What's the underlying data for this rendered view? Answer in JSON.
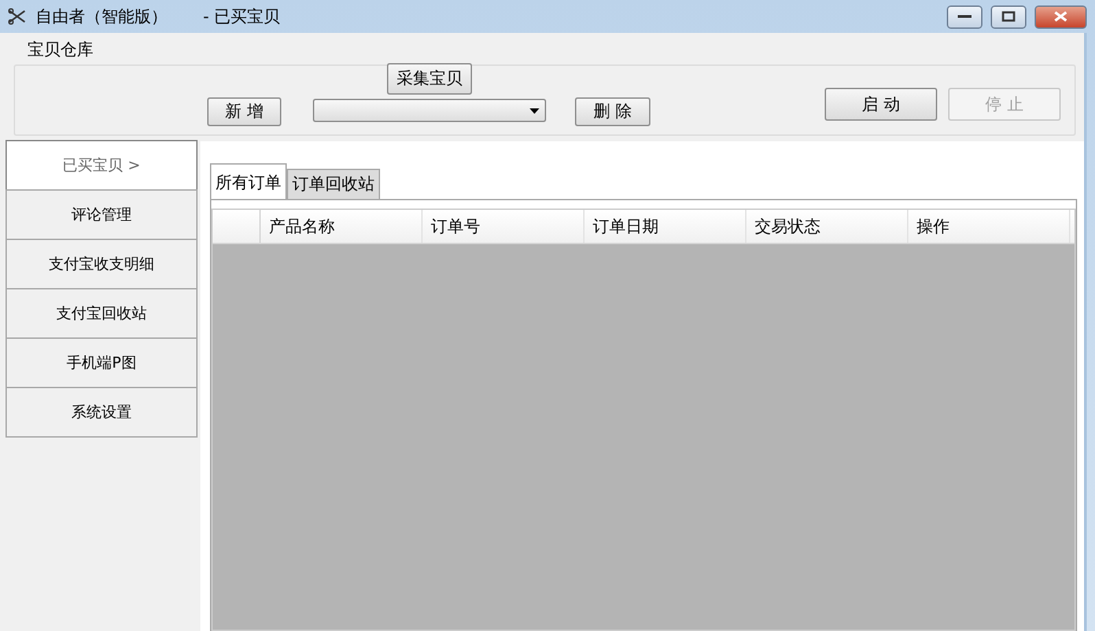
{
  "window": {
    "title": "自由者（智能版）",
    "subtitle": "- 已买宝贝"
  },
  "toolbar": {
    "group_label": "宝贝仓库",
    "collect_button": "采集宝贝",
    "add_button": "新 增",
    "delete_button": "删 除",
    "start_button": {
      "label": "启 动",
      "disabled": false
    },
    "stop_button": {
      "label": "停 止",
      "disabled": true
    }
  },
  "sidebar": {
    "items": [
      {
        "label": "已买宝贝 >",
        "selected": true
      },
      {
        "label": "评论管理",
        "selected": false
      },
      {
        "label": "支付宝收支明细",
        "selected": false
      },
      {
        "label": "支付宝回收站",
        "selected": false
      },
      {
        "label": "手机端P图",
        "selected": false
      },
      {
        "label": "系统设置",
        "selected": false
      }
    ]
  },
  "tabs": [
    {
      "label": "所有订单",
      "selected": true
    },
    {
      "label": "订单回收站",
      "selected": false
    }
  ],
  "table": {
    "columns": [
      "产品名称",
      "订单号",
      "订单日期",
      "交易状态",
      "操作"
    ]
  }
}
